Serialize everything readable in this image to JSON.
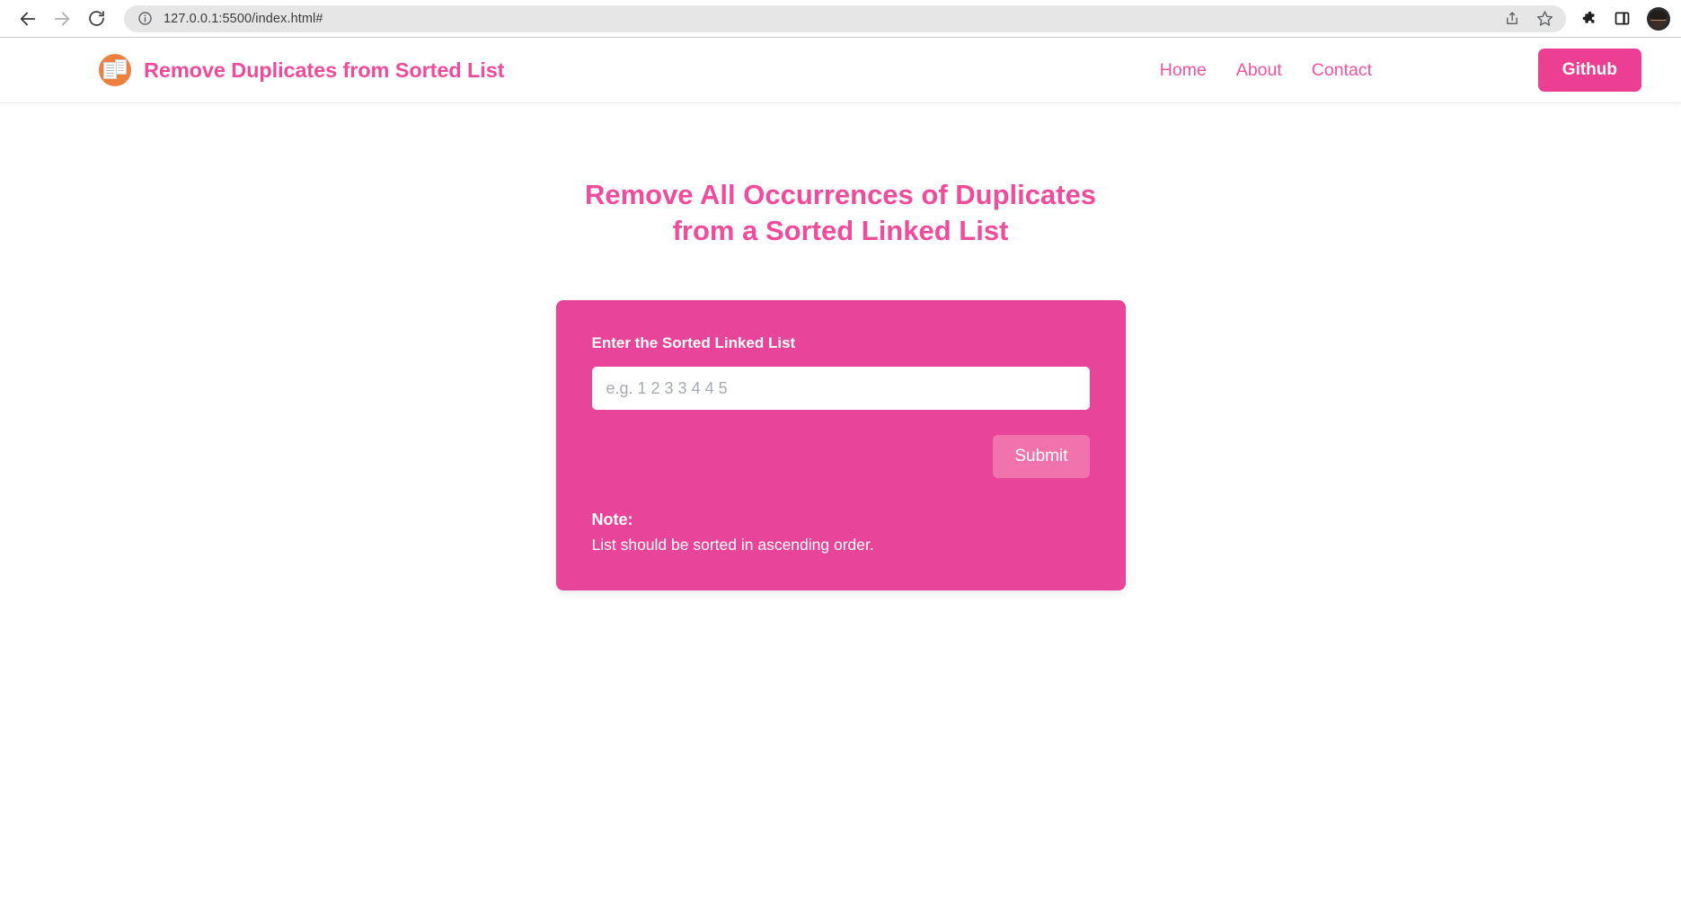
{
  "browser": {
    "back_label": "Back",
    "forward_label": "Forward",
    "reload_label": "Reload",
    "site_info_label": "View site information",
    "url": "127.0.0.1:5500/index.html#",
    "share_label": "Share this page",
    "bookmark_label": "Bookmark this tab",
    "extensions_label": "Extensions",
    "side_panel_label": "Side panel",
    "profile_label": "Profile"
  },
  "header": {
    "logo_name": "duplicate-pages-logo",
    "brand_title": "Remove Duplicates from Sorted List",
    "nav": [
      {
        "label": "Home",
        "name": "home"
      },
      {
        "label": "About",
        "name": "about"
      },
      {
        "label": "Contact",
        "name": "contact"
      }
    ],
    "github_label": "Github"
  },
  "main": {
    "title": "Remove All Occurrences of Duplicates from a Sorted Linked List",
    "card": {
      "input_label": "Enter the Sorted Linked List",
      "input_value": "",
      "input_placeholder": "e.g. 1 2 3 3 4 4 5",
      "submit_label": "Submit",
      "note_title": "Note:",
      "note_text": "List should be sorted in ascending order."
    }
  },
  "colors": {
    "brand_pink": "#ee4c9b",
    "card_pink": "#e8459a",
    "submit_pink": "#f173ae",
    "github_pink": "#ec3f93",
    "logo_orange": "#ef7f3e"
  }
}
